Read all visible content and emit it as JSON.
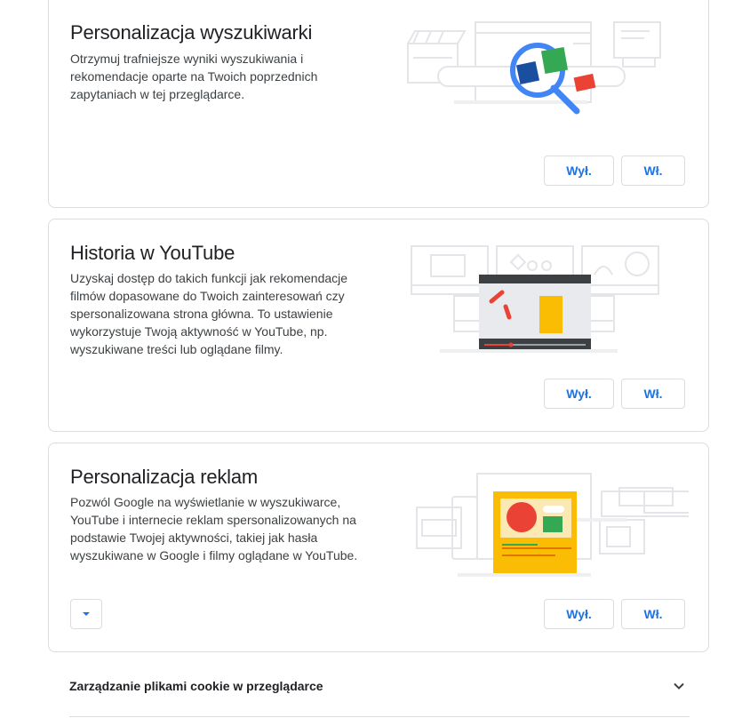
{
  "cards": [
    {
      "title": "Personalizacja wyszukiwarki",
      "description": "Otrzymuj trafniejsze wyniki wyszukiwania i rekomendacje oparte na Twoich poprzednich zapytaniach w tej przeglądarce.",
      "off_label": "Wył.",
      "on_label": "Wł.",
      "icon": "search-personalization-illustration"
    },
    {
      "title": "Historia w YouTube",
      "description": "Uzyskaj dostęp do takich funkcji jak rekomendacje filmów dopasowane do Twoich zainteresowań czy spersonalizowana strona główna. To ustawienie wykorzystuje Twoją aktywność w YouTube, np. wyszukiwane treści lub oglądane filmy.",
      "off_label": "Wył.",
      "on_label": "Wł.",
      "icon": "youtube-history-illustration"
    },
    {
      "title": "Personalizacja reklam",
      "description": "Pozwól Google na wyświetlanie w wyszukiwarce, YouTube i internecie reklam spersonalizowanych na podstawie Twojej aktywności, takiej jak hasła wyszukiwane w Google i filmy oglądane w YouTube.",
      "off_label": "Wył.",
      "on_label": "Wł.",
      "icon": "ad-personalization-illustration",
      "expand_icon": "caret-down-icon"
    }
  ],
  "cookie_section": {
    "label": "Zarządzanie plikami cookie w przeglądarce",
    "icon": "chevron-down-icon"
  },
  "colors": {
    "accent": "#1a73e8",
    "border": "#dadce0",
    "google_blue": "#4285f4",
    "google_red": "#ea4335",
    "google_yellow": "#fbbc04",
    "google_green": "#34a853"
  }
}
